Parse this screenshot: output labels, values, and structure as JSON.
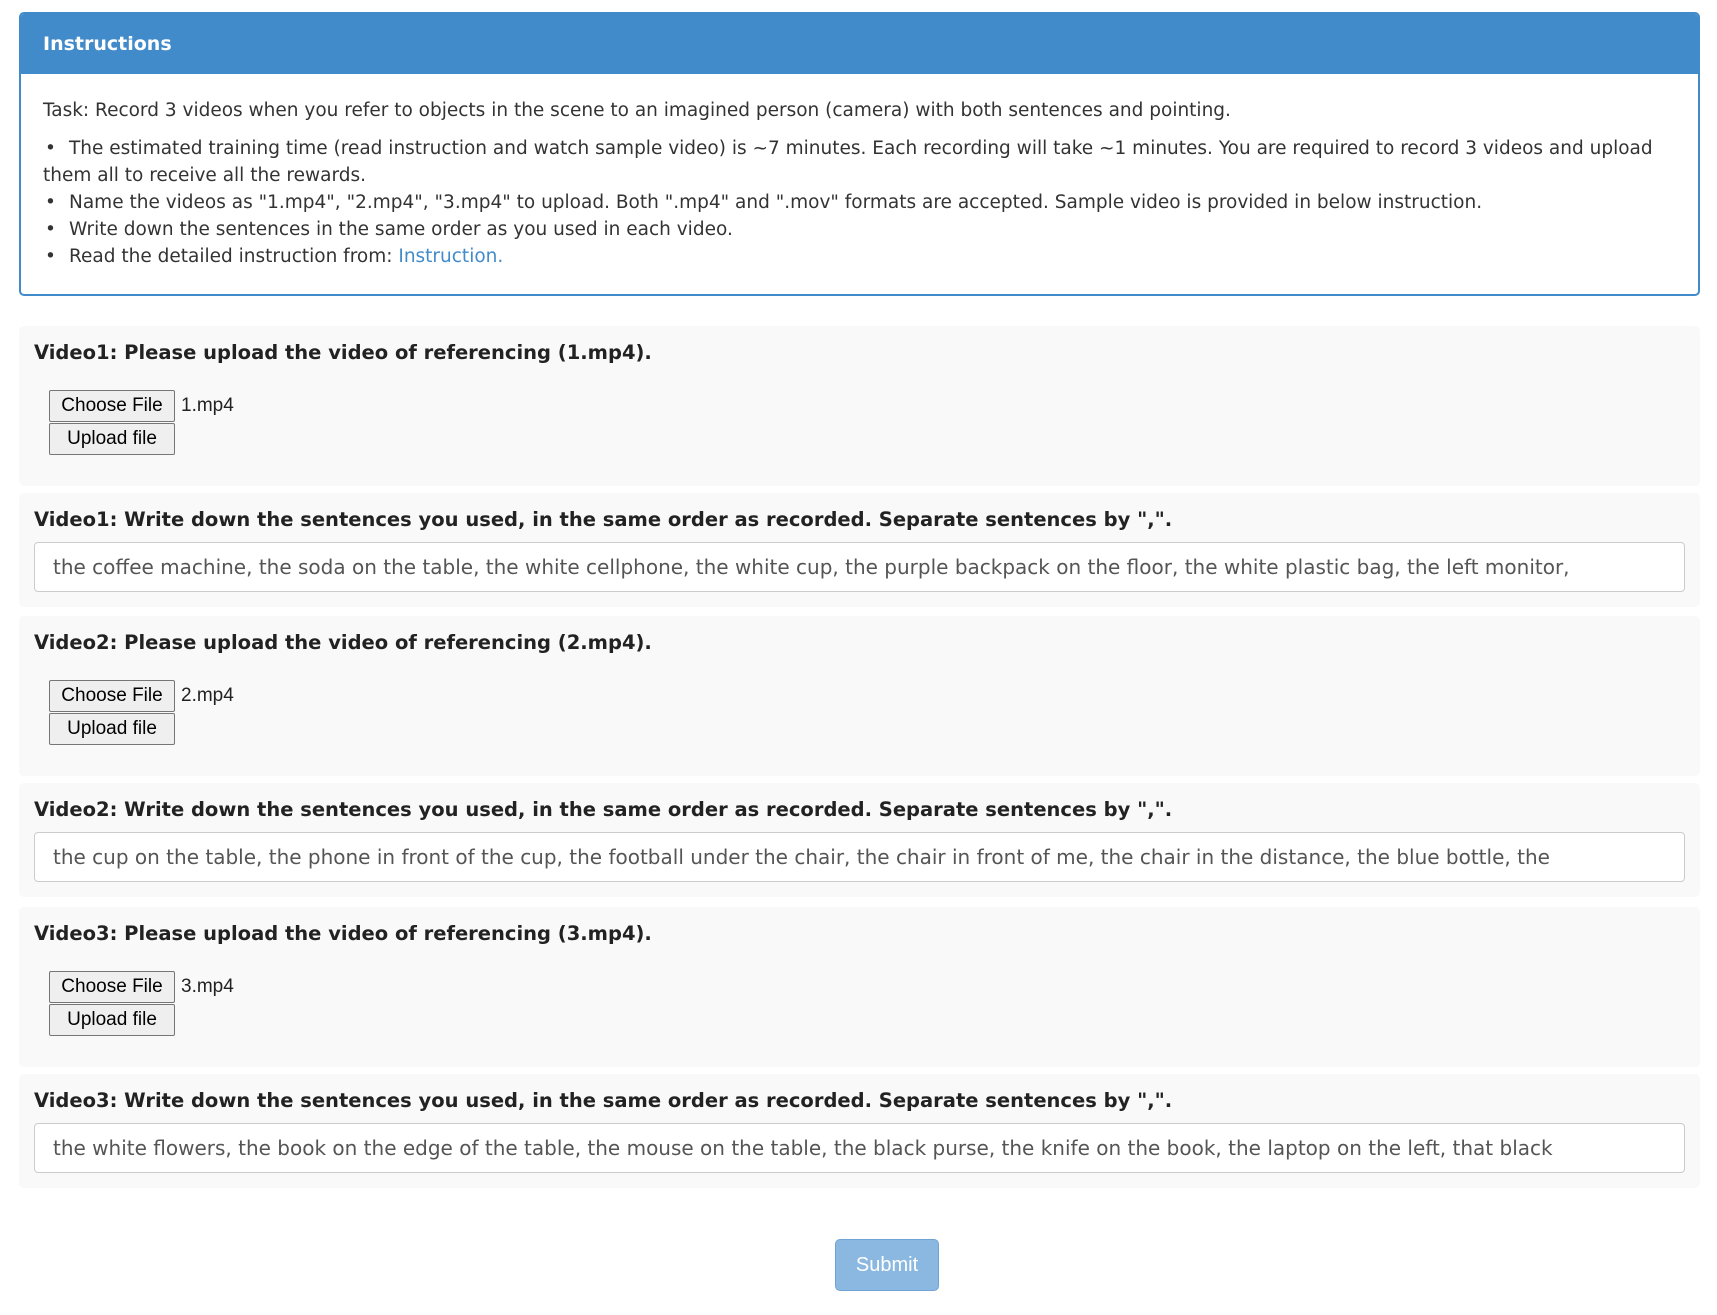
{
  "instructions": {
    "title": "Instructions",
    "task": "Task: Record 3 videos when you refer to objects in the scene to an imagined person (camera) with both sentences and pointing.",
    "bullets": [
      "The estimated training time (read instruction and watch sample video) is ~7 minutes. Each recording will take ~1 minutes. You are required to record 3 videos and upload them all to receive all the rewards.",
      "Name the videos as \"1.mp4\", \"2.mp4\", \"3.mp4\" to upload. Both \".mp4\" and \".mov\" formats are accepted. Sample video is provided in below instruction.",
      "Write down the sentences in the same order as you used in each video."
    ],
    "read_more_prefix": "Read the detailed instruction from: ",
    "read_more_link": "Instruction."
  },
  "common": {
    "choose_file": "Choose File",
    "upload_file": "Upload file",
    "submit": "Submit"
  },
  "videos": [
    {
      "upload_label": "Video1: Please upload the video of referencing (1.mp4).",
      "file_name": "1.mp4",
      "sentences_label": "Video1: Write down the sentences you used, in the same order as recorded. Separate sentences by \",\".",
      "sentences_value": "the coffee machine, the soda on the table, the white cellphone, the white cup, the purple backpack on the floor, the white plastic bag, the left monitor,"
    },
    {
      "upload_label": "Video2: Please upload the video of referencing (2.mp4).",
      "file_name": "2.mp4",
      "sentences_label": "Video2: Write down the sentences you used, in the same order as recorded. Separate sentences by \",\".",
      "sentences_value": "the cup on the table, the phone in front of the cup, the football under the chair, the chair in front of me, the chair in the distance, the blue bottle, the"
    },
    {
      "upload_label": "Video3: Please upload the video of referencing (3.mp4).",
      "file_name": "3.mp4",
      "sentences_label": "Video3: Write down the sentences you used, in the same order as recorded. Separate sentences by \",\".",
      "sentences_value": "the white flowers, the book on the edge of the table, the mouse on the table, the black purse, the knife on the book, the laptop on the left, that black"
    }
  ]
}
